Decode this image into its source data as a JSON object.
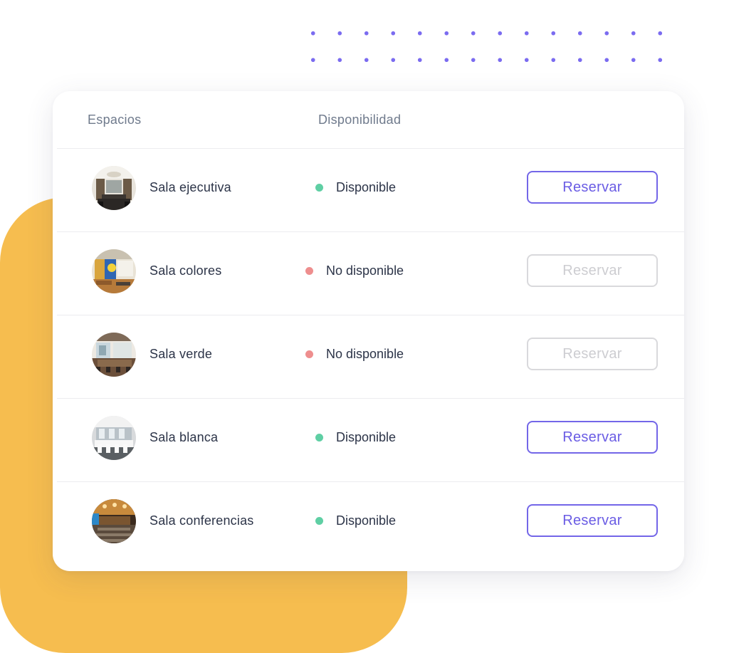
{
  "table": {
    "headers": {
      "spaces": "Espacios",
      "availability": "Disponibilidad"
    },
    "rows": [
      {
        "name": "Sala ejecutiva",
        "status": "Disponible",
        "available": true,
        "action": "Reservar"
      },
      {
        "name": "Sala colores",
        "status": "No disponible",
        "available": false,
        "action": "Reservar"
      },
      {
        "name": "Sala verde",
        "status": "No disponible",
        "available": false,
        "action": "Reservar"
      },
      {
        "name": "Sala blanca",
        "status": "Disponible",
        "available": true,
        "action": "Reservar"
      },
      {
        "name": "Sala conferencias",
        "status": "Disponible",
        "available": true,
        "action": "Reservar"
      }
    ]
  },
  "colors": {
    "accent": "#6a5ce4",
    "available_dot": "#5fcfa4",
    "unavailable_dot": "#ee8e8e",
    "background_shape": "#f6bd4f"
  }
}
